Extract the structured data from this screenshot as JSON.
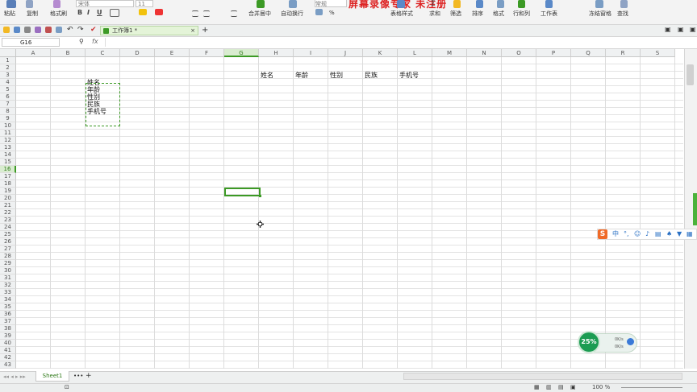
{
  "ribbon": {
    "paste_label": "粘贴",
    "copy_label": "复制",
    "format_painter_label": "格式刷",
    "font_name": "宋体",
    "font_size": "11",
    "bold": "B",
    "italic": "I",
    "underline": "U",
    "merge_center_label": "合并居中",
    "wrap_text_label": "自动换行",
    "number_format": "常规",
    "table_style_label": "表格样式",
    "sum_label": "求和",
    "filter_label": "筛选",
    "sort_label": "排序",
    "format_label": "格式",
    "rows_cols_label": "行和列",
    "worksheet_label": "工作表",
    "freeze_label": "冻结窗格",
    "find_label": "查找",
    "watermark_text": "屏幕录像专家 未注册"
  },
  "quickbar": {
    "doc_tab_label": "工作簿1 *",
    "add_tab": "+",
    "close_tab": "×"
  },
  "formula_bar": {
    "name_box": "G16",
    "fx_label": "fx",
    "formula": ""
  },
  "sheet": {
    "columns": [
      "A",
      "B",
      "C",
      "D",
      "E",
      "F",
      "G",
      "H",
      "I",
      "J",
      "K",
      "L",
      "M",
      "N",
      "O",
      "P",
      "Q",
      "R",
      "S"
    ],
    "selected_column": "G",
    "selected_row": 16,
    "row_count": 43,
    "cells": [
      {
        "ref": "C4",
        "text": "姓名"
      },
      {
        "ref": "C5",
        "text": "年龄"
      },
      {
        "ref": "C6",
        "text": "性别"
      },
      {
        "ref": "C7",
        "text": "民族"
      },
      {
        "ref": "C8",
        "text": "手机号"
      },
      {
        "ref": "H3",
        "text": "姓名"
      },
      {
        "ref": "I3",
        "text": "年龄"
      },
      {
        "ref": "J3",
        "text": "性别"
      },
      {
        "ref": "K3",
        "text": "民族"
      },
      {
        "ref": "L3",
        "text": "手机号"
      }
    ]
  },
  "sheet_tabs": {
    "active_sheet": "Sheet1",
    "more": "•••",
    "add": "+"
  },
  "status_bar": {
    "zoom": "100 %"
  },
  "ime": {
    "logo": "S",
    "mode": "中"
  },
  "speed_widget": {
    "percent": "25%",
    "up": "0K/s",
    "down": "0K/s"
  },
  "colors": {
    "accent_green": "#3c9a25",
    "ribbon_bg": "#f3f3f3",
    "watermark_red": "#dd2222"
  }
}
